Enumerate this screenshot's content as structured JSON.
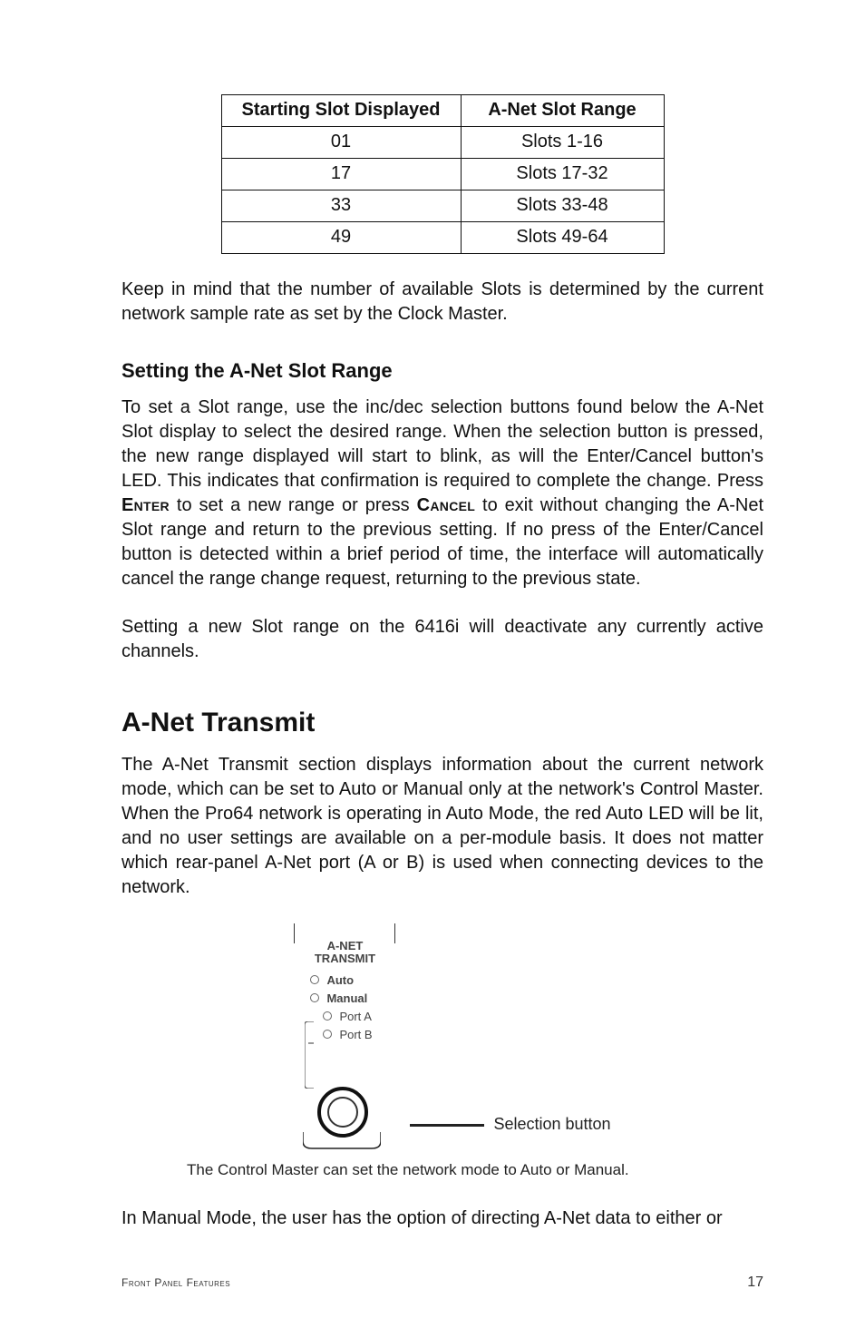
{
  "table": {
    "headers": [
      "Starting Slot Displayed",
      "A-Net Slot Range"
    ],
    "rows": [
      [
        "01",
        "Slots 1-16"
      ],
      [
        "17",
        "Slots 17-32"
      ],
      [
        "33",
        "Slots 33-48"
      ],
      [
        "49",
        "Slots 49-64"
      ]
    ]
  },
  "para1": "Keep in mind that the number of available Slots is determined by the current network sample rate as set by the Clock Master.",
  "subhead1": "Setting the A-Net Slot Range",
  "para2a": "To set a Slot range, use the inc/dec selection buttons found below the A-Net Slot display to select the desired range. When the selection button is pressed, the new range displayed will start to blink, as will the Enter/Cancel button's LED. This indicates that confirmation is required to complete the change. Press ",
  "enter": "Enter",
  "para2b": " to set a new range or press ",
  "cancel": "Cancel",
  "para2c": " to exit without changing the A-Net Slot range and return to the previous setting. If no press of the Enter/Cancel button is detected within a brief period of time, the interface will automatically cancel the range change request, returning to the previous state.",
  "para3": "Setting a new Slot range on the 6416i will deactivate any currently active channels.",
  "section": "A-Net Transmit",
  "para4": "The A-Net Transmit section displays information about the current network mode, which can be set to Auto or Manual only at the network's Control Master. When the Pro64 network is operating in Auto Mode, the red Auto LED will be lit, and no user settings are available on a per-module basis. It does not matter which rear-panel A-Net port (A or B) is used when connecting devices to the network.",
  "figure": {
    "title_line1": "A-NET",
    "title_line2": "TRANSMIT",
    "opt_auto": "Auto",
    "opt_manual": "Manual",
    "opt_porta": "Port A",
    "opt_portb": "Port B",
    "lead_label": "Selection button"
  },
  "caption": "The Control Master can set the network mode to Auto or Manual.",
  "para5": "In Manual Mode, the user has the option of directing A-Net data to either or",
  "footer": {
    "left": "Front Panel Features",
    "right": "17"
  }
}
